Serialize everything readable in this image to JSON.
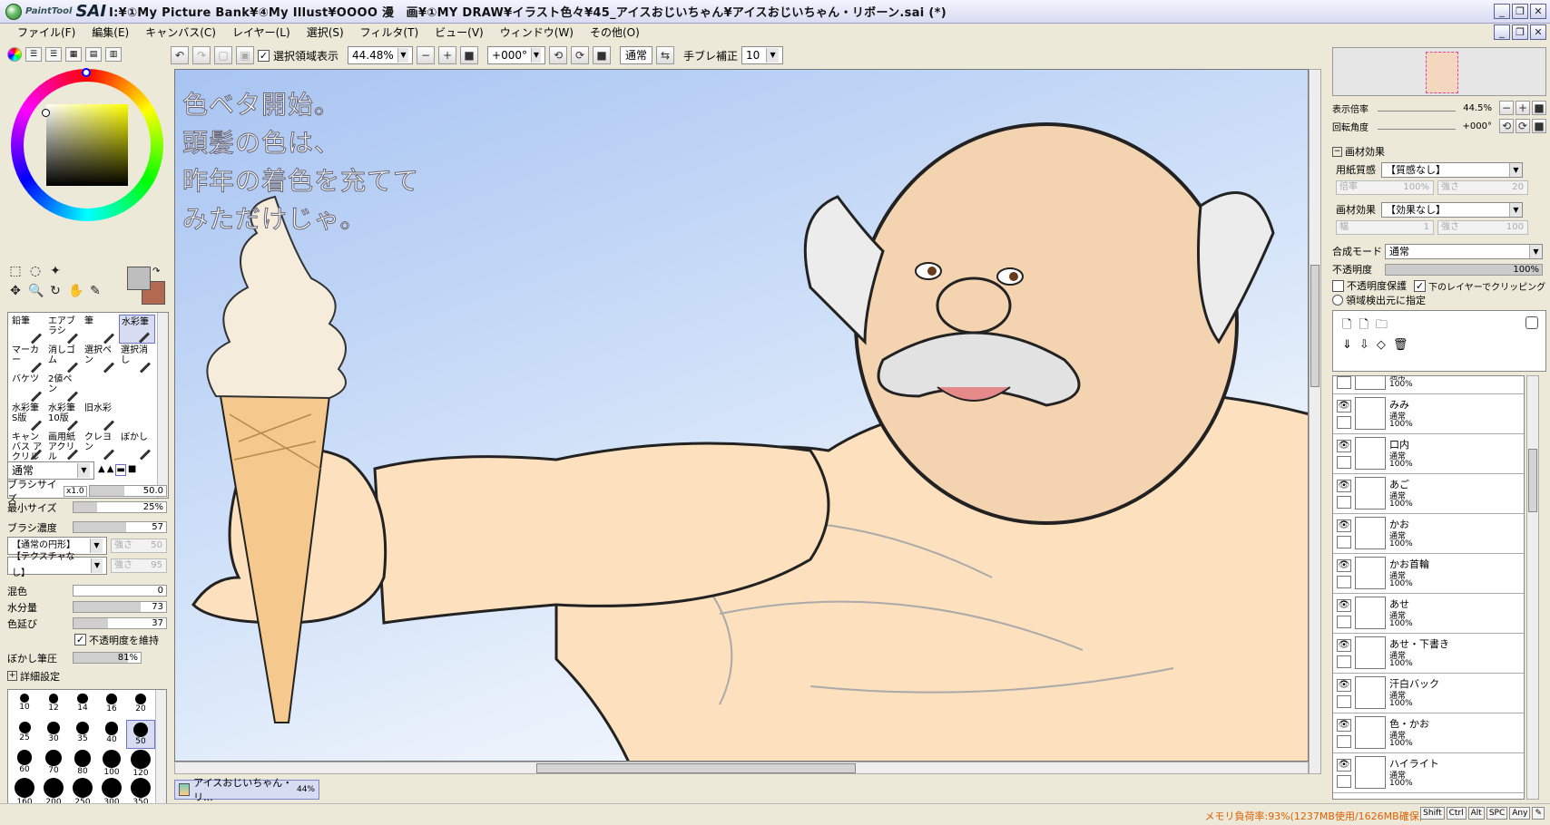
{
  "app": {
    "logo_small": "PaintTool",
    "logo_big": "SAI",
    "title": "I:¥①My Picture Bank¥④My Illust¥OOOO 漫　画¥①MY DRAW¥イラスト色々¥45_アイスおじいちゃん¥アイスおじいちゃん・リボーン.sai (*)"
  },
  "menu": [
    "ファイル(F)",
    "編集(E)",
    "キャンバス(C)",
    "レイヤー(L)",
    "選択(S)",
    "フィルタ(T)",
    "ビュー(V)",
    "ウィンドウ(W)",
    "その他(O)"
  ],
  "toolbar": {
    "selection_display": "選択領域表示",
    "zoom": "44.48%",
    "rotation": "+000°",
    "blend": "通常",
    "stabilizer_label": "手ブレ補正",
    "stabilizer_value": "10"
  },
  "colors": {
    "primary": "#bebebe",
    "secondary": "#b36a50"
  },
  "tools": [
    {
      "name": "鉛筆"
    },
    {
      "name": "エアブラシ"
    },
    {
      "name": "筆"
    },
    {
      "name": "水彩筆"
    },
    {
      "name": "マーカー"
    },
    {
      "name": "消しゴム"
    },
    {
      "name": "選択ペン"
    },
    {
      "name": "選択消し"
    },
    {
      "name": "バケツ"
    },
    {
      "name": "2値ペン"
    },
    {
      "name": ""
    },
    {
      "name": ""
    },
    {
      "name": "水彩筆 S版"
    },
    {
      "name": "水彩筆 10版"
    },
    {
      "name": "旧水彩"
    },
    {
      "name": ""
    },
    {
      "name": "キャンバス アクリル"
    },
    {
      "name": "画用紙 アクリル"
    },
    {
      "name": "クレヨン"
    },
    {
      "name": "ぼかし"
    }
  ],
  "brush": {
    "mode": "通常",
    "size_label": "ブラシサイズ",
    "size_mult": "x1.0",
    "size_value": "50.0",
    "min_label": "最小サイズ",
    "min_value": "25%",
    "min_pct": 25,
    "density_label": "ブラシ濃度",
    "density_value": "57",
    "density_pct": 57,
    "shape": "【通常の円形】",
    "shape_strength_label": "強さ",
    "shape_strength": "50",
    "texture": "【テクスチャなし】",
    "texture_strength_label": "強さ",
    "texture_strength": "95",
    "mix_label": "混色",
    "mix_value": "0",
    "mix_pct": 0,
    "water_label": "水分量",
    "water_value": "73",
    "water_pct": 73,
    "extend_label": "色延び",
    "extend_value": "37",
    "extend_pct": 37,
    "keep_opacity_label": "不透明度を維持",
    "blur_label": "ぼかし筆圧",
    "blur_value": "81%",
    "blur_pct": 81,
    "detail_label": "詳細設定"
  },
  "brush_sizes": [
    "10",
    "12",
    "14",
    "16",
    "20",
    "25",
    "30",
    "35",
    "40",
    "50",
    "60",
    "70",
    "80",
    "100",
    "120",
    "160",
    "200",
    "250",
    "300",
    "350"
  ],
  "canvas_text": [
    "色ベタ開始。",
    "頭髪の色は、",
    "昨年の着色を充てて",
    "みただけじゃ。"
  ],
  "document_tab": {
    "name": "アイスおじいちゃん・リ...",
    "zoom": "44%"
  },
  "navigator": {
    "zoom_label": "表示倍率",
    "zoom_value": "44.5%",
    "angle_label": "回転角度",
    "angle_value": "+000°"
  },
  "paper": {
    "header": "画材効果",
    "texture_label": "用紙質感",
    "texture_value": "【質感なし】",
    "scale_label": "倍率",
    "scale_value": "100%",
    "strength_label": "強さ",
    "strength_value": "20",
    "effect_label": "画材効果",
    "effect_value": "【効果なし】",
    "width_label": "幅",
    "width_value": "1",
    "strength2_value": "100"
  },
  "layer_props": {
    "blend_label": "合成モード",
    "blend_value": "通常",
    "opacity_label": "不透明度",
    "opacity_value": "100%",
    "protect_label": "不透明度保護",
    "clip_label": "下のレイヤーでクリッピング",
    "select_src_label": "領域検出元に指定"
  },
  "layers": [
    {
      "name": "",
      "mode": "通常",
      "opacity": "100%"
    },
    {
      "name": "みみ",
      "mode": "通常",
      "opacity": "100%"
    },
    {
      "name": "口内",
      "mode": "通常",
      "opacity": "100%"
    },
    {
      "name": "あご",
      "mode": "通常",
      "opacity": "100%"
    },
    {
      "name": "かお",
      "mode": "通常",
      "opacity": "100%"
    },
    {
      "name": "かお首輪",
      "mode": "通常",
      "opacity": "100%"
    },
    {
      "name": "あせ",
      "mode": "通常",
      "opacity": "100%"
    },
    {
      "name": "あせ・下書き",
      "mode": "通常",
      "opacity": "100%"
    },
    {
      "name": "汗白バック",
      "mode": "通常",
      "opacity": "100%"
    },
    {
      "name": "色・かお",
      "mode": "通常",
      "opacity": "100%"
    },
    {
      "name": "ハイライト",
      "mode": "通常",
      "opacity": "100%"
    }
  ],
  "status": {
    "memory": "メモリ負荷率:93%(1237MB使用/1626MB確保)",
    "keys": [
      "Shift",
      "Ctrl",
      "Alt",
      "SPC",
      "Any"
    ]
  }
}
